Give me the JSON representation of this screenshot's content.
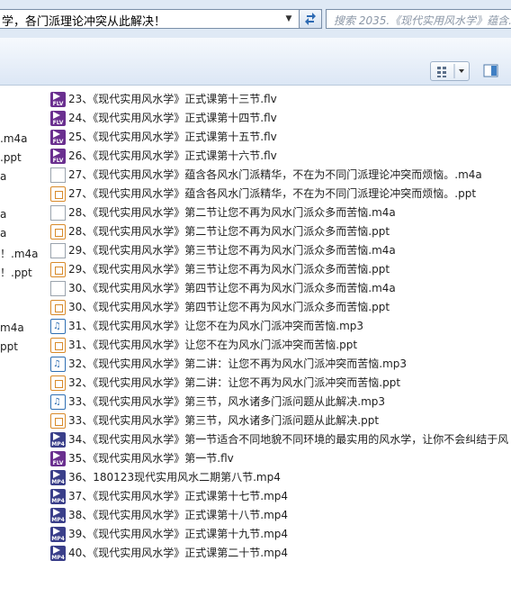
{
  "address_bar": {
    "path_text": "学，各门派理论冲突从此解决！",
    "search_placeholder": "搜索 2035.《现代实用风水学》蕴含..."
  },
  "icons": {
    "dropdown": "chevron-down-icon",
    "refresh": "refresh-icon",
    "views": "view-options-icon",
    "preview": "preview-pane-icon"
  },
  "left_column_fragments": [
    ".m4a",
    ".ppt",
    "a",
    "a",
    "a",
    "！.m4a",
    "！.ppt",
    "m4a",
    "ppt"
  ],
  "files": [
    {
      "type": "flv",
      "name": "23、《现代实用风水学》正式课第十三节.flv"
    },
    {
      "type": "flv",
      "name": "24、《现代实用风水学》正式课第十四节.flv"
    },
    {
      "type": "flv",
      "name": "25、《现代实用风水学》正式课第十五节.flv"
    },
    {
      "type": "flv",
      "name": "26、《现代实用风水学》正式课第十六节.flv"
    },
    {
      "type": "doc",
      "name": "27、《现代实用风水学》蕴含各风水门派精华，不在为不同门派理论冲突而烦恼。.m4a"
    },
    {
      "type": "ppt",
      "name": "27、《现代实用风水学》蕴含各风水门派精华，不在为不同门派理论冲突而烦恼。.ppt"
    },
    {
      "type": "doc",
      "name": "28、《现代实用风水学》第二节让您不再为风水门派众多而苦恼.m4a"
    },
    {
      "type": "ppt",
      "name": "28、《现代实用风水学》第二节让您不再为风水门派众多而苦恼.ppt"
    },
    {
      "type": "doc",
      "name": "29、《现代实用风水学》第三节让您不再为风水门派众多而苦恼.m4a"
    },
    {
      "type": "ppt",
      "name": "29、《现代实用风水学》第三节让您不再为风水门派众多而苦恼.ppt"
    },
    {
      "type": "doc",
      "name": "30、《现代实用风水学》第四节让您不再为风水门派众多而苦恼.m4a"
    },
    {
      "type": "ppt",
      "name": "30、《现代实用风水学》第四节让您不再为风水门派众多而苦恼.ppt"
    },
    {
      "type": "mp3",
      "name": "31、《现代实用风水学》让您不在为风水门派冲突而苦恼.mp3"
    },
    {
      "type": "ppt",
      "name": "31、《现代实用风水学》让您不在为风水门派冲突而苦恼.ppt"
    },
    {
      "type": "mp3",
      "name": "32、《现代实用风水学》第二讲：让您不再为风水门派冲突而苦恼.mp3"
    },
    {
      "type": "ppt",
      "name": "32、《现代实用风水学》第二讲：让您不再为风水门派冲突而苦恼.ppt"
    },
    {
      "type": "mp3",
      "name": "33、《现代实用风水学》第三节，风水诸多门派问题从此解决.mp3"
    },
    {
      "type": "ppt",
      "name": "33、《现代实用风水学》第三节，风水诸多门派问题从此解决.ppt"
    },
    {
      "type": "mp4",
      "name": "34、《现代实用风水学》第一节适合不同地貌不同环境的最实用的风水学，让你不会纠结于风"
    },
    {
      "type": "flv",
      "name": "35、《现代实用风水学》第一节.flv"
    },
    {
      "type": "mp4",
      "name": "36、180123现代实用风水二期第八节.mp4"
    },
    {
      "type": "mp4",
      "name": "37、《现代实用风水学》正式课第十七节.mp4"
    },
    {
      "type": "mp4",
      "name": "38、《现代实用风水学》正式课第十八节.mp4"
    },
    {
      "type": "mp4",
      "name": "39、《现代实用风水学》正式课第十九节.mp4"
    },
    {
      "type": "mp4",
      "name": "40、《现代实用风水学》正式课第二十节.mp4"
    }
  ],
  "badges": {
    "flv": "FLV",
    "mp4": "MP4",
    "mp3": "♫"
  }
}
